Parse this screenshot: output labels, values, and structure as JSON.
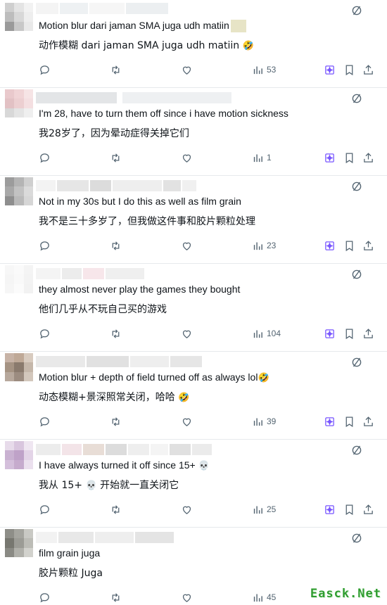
{
  "watermark": "Easck.Net",
  "posts": [
    {
      "original": "Motion blur dari jaman SMA juga udh matiin",
      "translation": "动作模糊 dari jaman SMA juga udh matiin",
      "translation_emoji": "🤣",
      "views": "53"
    },
    {
      "original": "I'm 28, have to turn them off since i have motion sickness",
      "translation": "我28岁了，因为晕动症得关掉它们",
      "views": "1"
    },
    {
      "original": "Not in my 30s but I do this as well as film grain",
      "translation": "我不是三十多岁了，但我做这件事和胶片颗粒处理",
      "views": "23"
    },
    {
      "original": "they almost never play the games they bought",
      "translation": "他们几乎从不玩自己买的游戏",
      "views": "104"
    },
    {
      "original": "Motion blur + depth of field turned off as always lol",
      "original_emoji": "🤣",
      "translation": "动态模糊+景深照常关闭，哈哈",
      "translation_emoji": "🤣",
      "views": "39"
    },
    {
      "original": "I have always turned it off since 15+",
      "original_emoji": "💀",
      "translation_pre": "我从 15+",
      "translation_emoji": "💀",
      "translation_post": "开始就一直关闭它",
      "views": "25"
    },
    {
      "original": "film grain juga",
      "translation": "胶片颗粒 Juga",
      "views": "45"
    }
  ],
  "icons": {
    "reply": "reply-icon",
    "retweet": "retweet-icon",
    "like": "like-icon",
    "views": "views-icon",
    "grok": "grok-icon",
    "bookmark": "bookmark-icon",
    "share": "share-icon",
    "translate": "grok-translate-icon"
  },
  "colors": {
    "icon": "#536471",
    "accent": "#7856ff",
    "divider": "#e6e9ec",
    "watermark": "#2f9d2f"
  }
}
